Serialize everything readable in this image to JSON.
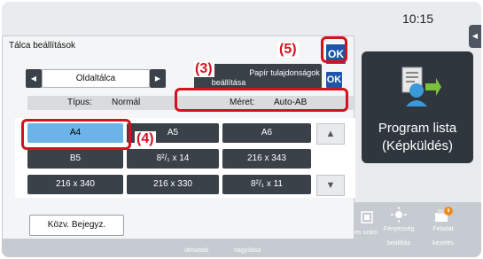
{
  "clock": "10:15",
  "panel": {
    "title": "Tálca beállítások",
    "nav_label": "Oldaltálca",
    "tab_left": "beállítása",
    "tab_right": "Papír tulajdonságok",
    "ok_main": "OK",
    "ok_small": "OK",
    "info": {
      "type_label": "Típus:",
      "type_value": "Normál",
      "size_label": "Méret:",
      "size_value": "Auto-AB"
    },
    "sizes": [
      "A4",
      "A5",
      "A6",
      "B5",
      "8²/₁ x 14",
      "216 x 343",
      "216 x 340",
      "216 x 330",
      "8²/₁ x 11"
    ],
    "scroll_up": "▲",
    "scroll_down": "▼",
    "common_button": "Közv. Bejegyz."
  },
  "program_list": {
    "line1": "Program lista",
    "line2": "(Képküldés)"
  },
  "bottom_bar": {
    "items": [
      {
        "icon": "guide-icon",
        "label": "útmutató"
      },
      {
        "icon": "zoom-icon",
        "label": "nagyítása"
      },
      {
        "icon": "counter-icon",
        "label": "es szám"
      },
      {
        "icon": "brightness-icon",
        "label1": "Fényesség",
        "label2": "beállítás"
      },
      {
        "icon": "job-status-icon",
        "label1": "Feladat",
        "label2": "kezelés"
      }
    ]
  },
  "callouts": {
    "c3": "(3)",
    "c4": "(4)",
    "c5": "(5)"
  },
  "colors": {
    "highlight": "#d6111f",
    "ok_blue": "#1d56a8",
    "selected": "#6ab4e8"
  }
}
